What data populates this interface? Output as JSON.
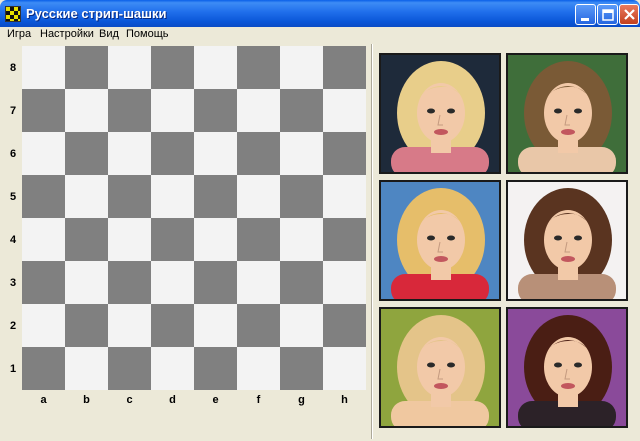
{
  "window": {
    "title": "Русские стрип-шашки"
  },
  "menu": {
    "items": [
      "Игра",
      "Настройки",
      "Вид",
      "Помощь"
    ]
  },
  "board": {
    "ranks": [
      "8",
      "7",
      "6",
      "5",
      "4",
      "3",
      "2",
      "1"
    ],
    "files": [
      "a",
      "b",
      "c",
      "d",
      "e",
      "f",
      "g",
      "h"
    ],
    "colors": {
      "dark": "#808080",
      "light": "#F3F3F3"
    }
  },
  "portraits": {
    "count": 6,
    "items": [
      {
        "name": "portrait-1",
        "hair": "#E8CE8A",
        "background": "#1E2A3A",
        "clothing": "#D77A88"
      },
      {
        "name": "portrait-2",
        "hair": "#7A5A36",
        "background": "#3F6E3A",
        "clothing": "#E9C7A8"
      },
      {
        "name": "portrait-3",
        "hair": "#E6BE6A",
        "background": "#4E86C2",
        "clothing": "#D8283A"
      },
      {
        "name": "portrait-4",
        "hair": "#5A3420",
        "background": "#F4F2F2",
        "clothing": "#B89078"
      },
      {
        "name": "portrait-5",
        "hair": "#E4C489",
        "background": "#8FA53E",
        "clothing": "#F0C8A0"
      },
      {
        "name": "portrait-6",
        "hair": "#4A1E14",
        "background": "#8A4A9A",
        "clothing": "#2C2228"
      }
    ]
  }
}
